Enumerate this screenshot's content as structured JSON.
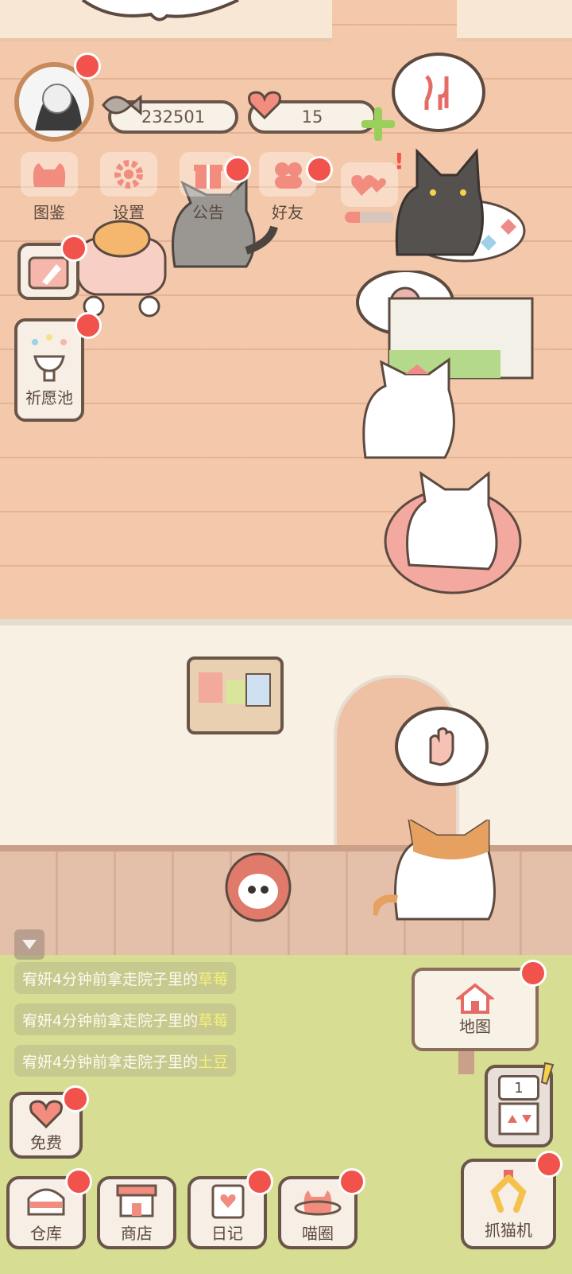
{
  "profile": {
    "coins": "232501",
    "hearts": "15"
  },
  "menu": [
    {
      "label": "图鉴",
      "icon": "cat-head-icon"
    },
    {
      "label": "设置",
      "icon": "gear-icon"
    },
    {
      "label": "公告",
      "icon": "gift-icon"
    },
    {
      "label": "好友",
      "icon": "friends-icon"
    },
    {
      "label": "",
      "icon": "hearts-icon"
    }
  ],
  "side": {
    "wish_pool": "祈愿池"
  },
  "messages": [
    {
      "prefix": "宥妍4分钟前拿走院子里的",
      "item": "草莓"
    },
    {
      "prefix": "宥妍4分钟前拿走院子里的",
      "item": "草莓"
    },
    {
      "prefix": "宥妍4分钟前拿走院子里的",
      "item": "土豆"
    }
  ],
  "map": {
    "label": "地图"
  },
  "machine": {
    "count": "1"
  },
  "free": {
    "label": "免费"
  },
  "bottom": [
    {
      "label": "仓库",
      "icon": "warehouse-icon"
    },
    {
      "label": "商店",
      "icon": "shop-icon"
    },
    {
      "label": "日记",
      "icon": "diary-icon"
    },
    {
      "label": "喵圈",
      "icon": "planet-cat-icon"
    }
  ],
  "claw": {
    "label": "抓猫机"
  },
  "colors": {
    "badge": "#f2524c",
    "outline": "#6a5549",
    "wall": "#f4c9ab",
    "grass": "#d7dd92"
  }
}
